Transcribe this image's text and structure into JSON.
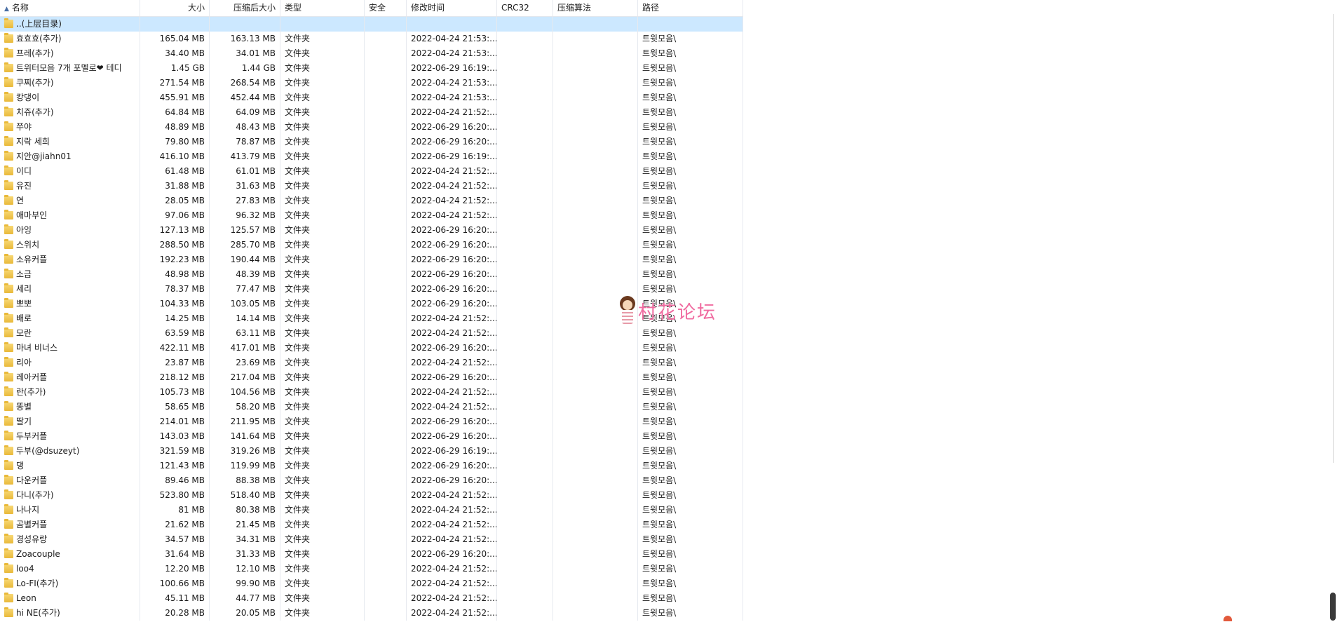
{
  "columns": {
    "name": "名称",
    "size": "大小",
    "packed": "压缩后大小",
    "type": "类型",
    "security": "安全",
    "modified": "修改时间",
    "crc": "CRC32",
    "method": "压缩算法",
    "path": "路径"
  },
  "parent_label": "..(上层目录)",
  "rows": [
    {
      "name": "효효효(추가)",
      "size": "165.04 MB",
      "packed": "163.13 MB",
      "type": "文件夹",
      "modified": "2022-04-24 21:53:...",
      "path": "트윗모음\\"
    },
    {
      "name": "프레(추가)",
      "size": "34.40 MB",
      "packed": "34.01 MB",
      "type": "文件夹",
      "modified": "2022-04-24 21:53:...",
      "path": "트윗모음\\"
    },
    {
      "name": "트위터모음 7개 포멜로❤ 테디",
      "size": "1.45 GB",
      "packed": "1.44 GB",
      "type": "文件夹",
      "modified": "2022-06-29 16:19:...",
      "path": "트윗모음\\"
    },
    {
      "name": "쿠찌(추가)",
      "size": "271.54 MB",
      "packed": "268.54 MB",
      "type": "文件夹",
      "modified": "2022-04-24 21:53:...",
      "path": "트윗모음\\"
    },
    {
      "name": "캉댕이",
      "size": "455.91 MB",
      "packed": "452.44 MB",
      "type": "文件夹",
      "modified": "2022-04-24 21:53:...",
      "path": "트윗모음\\"
    },
    {
      "name": "치쥬(추가)",
      "size": "64.84 MB",
      "packed": "64.09 MB",
      "type": "文件夹",
      "modified": "2022-04-24 21:52:...",
      "path": "트윗모음\\"
    },
    {
      "name": "쭈야",
      "size": "48.89 MB",
      "packed": "48.43 MB",
      "type": "文件夹",
      "modified": "2022-06-29 16:20:...",
      "path": "트윗모음\\"
    },
    {
      "name": "지락 세희",
      "size": "79.80 MB",
      "packed": "78.87 MB",
      "type": "文件夹",
      "modified": "2022-06-29 16:20:...",
      "path": "트윗모음\\"
    },
    {
      "name": "지안@jiahn01",
      "size": "416.10 MB",
      "packed": "413.79 MB",
      "type": "文件夹",
      "modified": "2022-06-29 16:19:...",
      "path": "트윗모음\\"
    },
    {
      "name": "이디",
      "size": "61.48 MB",
      "packed": "61.01 MB",
      "type": "文件夹",
      "modified": "2022-04-24 21:52:...",
      "path": "트윗모음\\"
    },
    {
      "name": "유진",
      "size": "31.88 MB",
      "packed": "31.63 MB",
      "type": "文件夹",
      "modified": "2022-04-24 21:52:...",
      "path": "트윗모음\\"
    },
    {
      "name": "연",
      "size": "28.05 MB",
      "packed": "27.83 MB",
      "type": "文件夹",
      "modified": "2022-04-24 21:52:...",
      "path": "트윗모음\\"
    },
    {
      "name": "애마부인",
      "size": "97.06 MB",
      "packed": "96.32 MB",
      "type": "文件夹",
      "modified": "2022-04-24 21:52:...",
      "path": "트윗모음\\"
    },
    {
      "name": "아잉",
      "size": "127.13 MB",
      "packed": "125.57 MB",
      "type": "文件夹",
      "modified": "2022-06-29 16:20:...",
      "path": "트윗모음\\"
    },
    {
      "name": "스위치",
      "size": "288.50 MB",
      "packed": "285.70 MB",
      "type": "文件夹",
      "modified": "2022-06-29 16:20:...",
      "path": "트윗모음\\"
    },
    {
      "name": "소유커플",
      "size": "192.23 MB",
      "packed": "190.44 MB",
      "type": "文件夹",
      "modified": "2022-06-29 16:20:...",
      "path": "트윗모음\\"
    },
    {
      "name": "소금",
      "size": "48.98 MB",
      "packed": "48.39 MB",
      "type": "文件夹",
      "modified": "2022-06-29 16:20:...",
      "path": "트윗모음\\"
    },
    {
      "name": "세리",
      "size": "78.37 MB",
      "packed": "77.47 MB",
      "type": "文件夹",
      "modified": "2022-06-29 16:20:...",
      "path": "트윗모음\\"
    },
    {
      "name": "뽀뽀",
      "size": "104.33 MB",
      "packed": "103.05 MB",
      "type": "文件夹",
      "modified": "2022-06-29 16:20:...",
      "path": "트윗모음\\"
    },
    {
      "name": "배로",
      "size": "14.25 MB",
      "packed": "14.14 MB",
      "type": "文件夹",
      "modified": "2022-04-24 21:52:...",
      "path": "트윗모음\\"
    },
    {
      "name": "모란",
      "size": "63.59 MB",
      "packed": "63.11 MB",
      "type": "文件夹",
      "modified": "2022-04-24 21:52:...",
      "path": "트윗모음\\"
    },
    {
      "name": "마녀 비너스",
      "size": "422.11 MB",
      "packed": "417.01 MB",
      "type": "文件夹",
      "modified": "2022-06-29 16:20:...",
      "path": "트윗모음\\"
    },
    {
      "name": "리아",
      "size": "23.87 MB",
      "packed": "23.69 MB",
      "type": "文件夹",
      "modified": "2022-04-24 21:52:...",
      "path": "트윗모음\\"
    },
    {
      "name": "레아커플",
      "size": "218.12 MB",
      "packed": "217.04 MB",
      "type": "文件夹",
      "modified": "2022-06-29 16:20:...",
      "path": "트윗모음\\"
    },
    {
      "name": "란(추가)",
      "size": "105.73 MB",
      "packed": "104.56 MB",
      "type": "文件夹",
      "modified": "2022-04-24 21:52:...",
      "path": "트윗모음\\"
    },
    {
      "name": "똥별",
      "size": "58.65 MB",
      "packed": "58.20 MB",
      "type": "文件夹",
      "modified": "2022-04-24 21:52:...",
      "path": "트윗모음\\"
    },
    {
      "name": "딸기",
      "size": "214.01 MB",
      "packed": "211.95 MB",
      "type": "文件夹",
      "modified": "2022-06-29 16:20:...",
      "path": "트윗모음\\"
    },
    {
      "name": "두부커플",
      "size": "143.03 MB",
      "packed": "141.64 MB",
      "type": "文件夹",
      "modified": "2022-06-29 16:20:...",
      "path": "트윗모음\\"
    },
    {
      "name": "두부(@dsuzeyt)",
      "size": "321.59 MB",
      "packed": "319.26 MB",
      "type": "文件夹",
      "modified": "2022-06-29 16:19:...",
      "path": "트윗모음\\"
    },
    {
      "name": "댕",
      "size": "121.43 MB",
      "packed": "119.99 MB",
      "type": "文件夹",
      "modified": "2022-06-29 16:20:...",
      "path": "트윗모음\\"
    },
    {
      "name": "다운커플",
      "size": "89.46 MB",
      "packed": "88.38 MB",
      "type": "文件夹",
      "modified": "2022-06-29 16:20:...",
      "path": "트윗모음\\"
    },
    {
      "name": "다니(추가)",
      "size": "523.80 MB",
      "packed": "518.40 MB",
      "type": "文件夹",
      "modified": "2022-04-24 21:52:...",
      "path": "트윗모음\\"
    },
    {
      "name": "나나지",
      "size": "81 MB",
      "packed": "80.38 MB",
      "type": "文件夹",
      "modified": "2022-04-24 21:52:...",
      "path": "트윗모음\\"
    },
    {
      "name": "곰별커플",
      "size": "21.62 MB",
      "packed": "21.45 MB",
      "type": "文件夹",
      "modified": "2022-04-24 21:52:...",
      "path": "트윗모음\\"
    },
    {
      "name": "경성유랑",
      "size": "34.57 MB",
      "packed": "34.31 MB",
      "type": "文件夹",
      "modified": "2022-04-24 21:52:...",
      "path": "트윗모음\\"
    },
    {
      "name": "Zoacouple",
      "size": "31.64 MB",
      "packed": "31.33 MB",
      "type": "文件夹",
      "modified": "2022-06-29 16:20:...",
      "path": "트윗모음\\"
    },
    {
      "name": "loo4",
      "size": "12.20 MB",
      "packed": "12.10 MB",
      "type": "文件夹",
      "modified": "2022-04-24 21:52:...",
      "path": "트윗모음\\"
    },
    {
      "name": "Lo-FI(추가)",
      "size": "100.66 MB",
      "packed": "99.90 MB",
      "type": "文件夹",
      "modified": "2022-04-24 21:52:...",
      "path": "트윗모음\\"
    },
    {
      "name": "Leon",
      "size": "45.11 MB",
      "packed": "44.77 MB",
      "type": "文件夹",
      "modified": "2022-04-24 21:52:...",
      "path": "트윗모음\\"
    },
    {
      "name": "hi NE(추가)",
      "size": "20.28 MB",
      "packed": "20.05 MB",
      "type": "文件夹",
      "modified": "2022-04-24 21:52:...",
      "path": "트윗모음\\"
    }
  ],
  "watermark": {
    "text": "村花论坛"
  },
  "colors": {
    "selected_row": "#cce8ff",
    "folder": "#e9b93a",
    "watermark": "#f06ba0"
  },
  "icons": {
    "folder": "folder-icon",
    "sort": "sort-ascending-icon"
  }
}
